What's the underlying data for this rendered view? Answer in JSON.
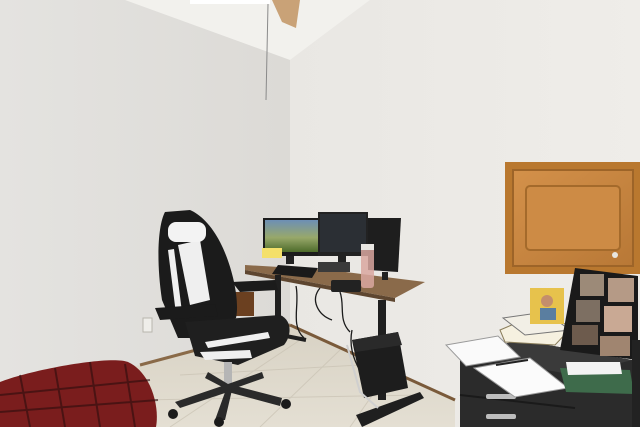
{
  "scene": {
    "description_type": "photo",
    "palette": {
      "wall_left": "#e6e5e2",
      "wall_right": "#eceae6",
      "ceiling": "#f1f0ec",
      "floor": "#d9d4c8",
      "baseboard": "#7a5a3a",
      "desk_top": "#8a6a4a",
      "desk_frame": "#1f1f1f",
      "chair_black": "#1b1b1b",
      "chair_white": "#f2f2f2",
      "cabinet_wood": "#c98a45",
      "cushion_red": "#7a1f1f",
      "drawer_dark": "#2c2c2c"
    },
    "objects": [
      "ceiling-fan",
      "gaming-chair",
      "standing-desk",
      "monitor-landscape",
      "monitor-center",
      "monitor-right",
      "keyboard",
      "water-bottle",
      "pc-tower",
      "wall-cabinet-door",
      "floor-cushion",
      "dark-drawer-unit",
      "notebooks",
      "photo-frames",
      "wall-outlet"
    ]
  }
}
